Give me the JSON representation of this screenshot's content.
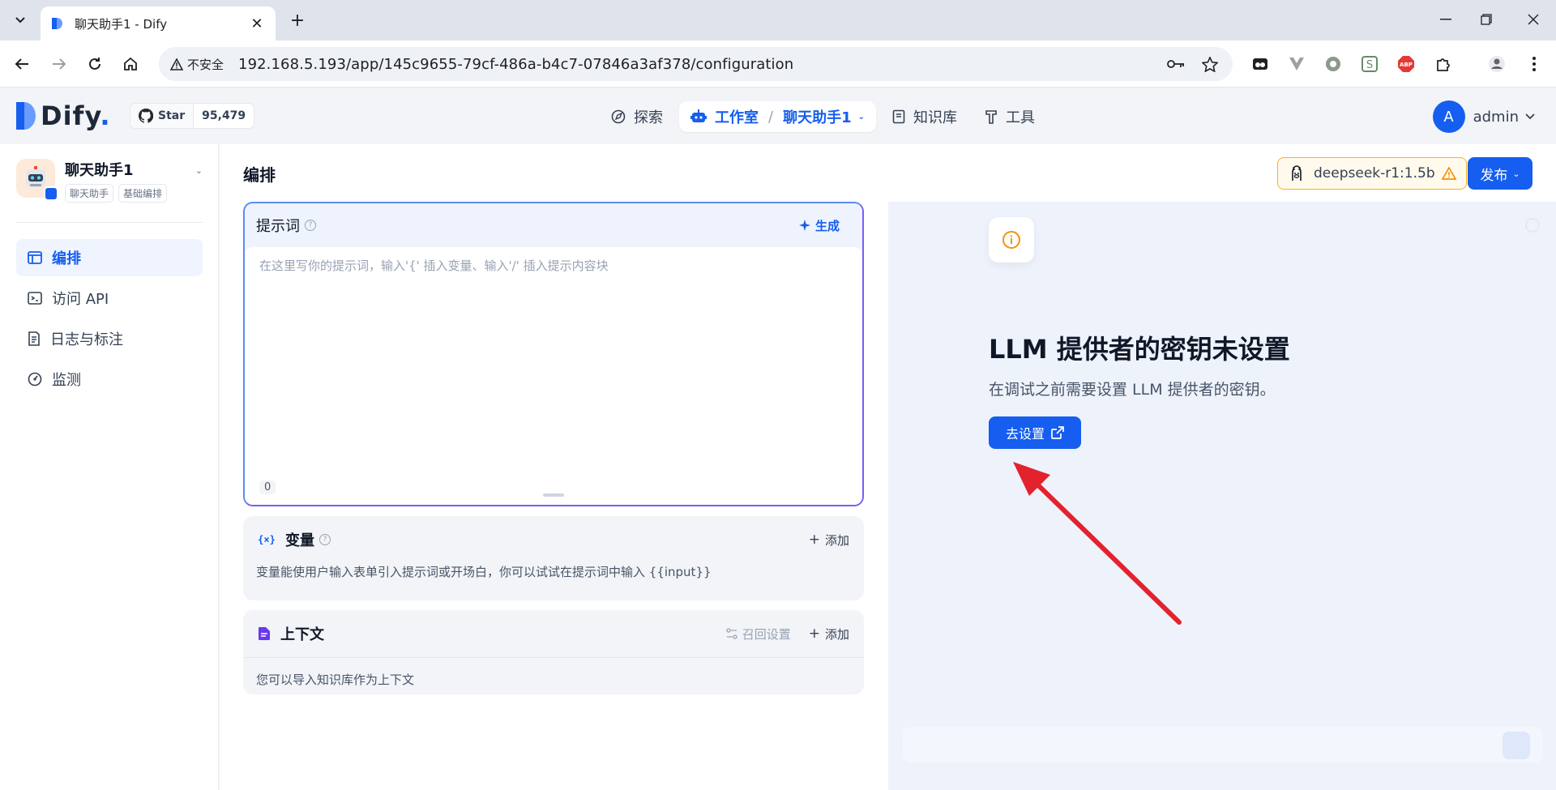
{
  "browser": {
    "tab_title": "聊天助手1 - Dify",
    "insecure_label": "不安全",
    "url": "192.168.5.193/app/145c9655-79cf-486a-b4c7-07846a3af378/configuration"
  },
  "header": {
    "logo_text": "Dify",
    "logo_suffix": ".",
    "star_label": "Star",
    "star_count": "95,479",
    "nav": {
      "explore": "探索",
      "studio": "工作室",
      "breadcrumb_sep": "/",
      "current_app": "聊天助手1",
      "knowledge": "知识库",
      "tools": "工具"
    },
    "user_initial": "A",
    "user_name": "admin"
  },
  "sidebar": {
    "app_name": "聊天助手1",
    "tags": [
      "聊天助手",
      "基础编排"
    ],
    "items": [
      {
        "label": "编排",
        "icon": "layout-icon",
        "active": true
      },
      {
        "label": "访问 API",
        "icon": "terminal-icon",
        "active": false
      },
      {
        "label": "日志与标注",
        "icon": "file-list-icon",
        "active": false
      },
      {
        "label": "监测",
        "icon": "dashboard-icon",
        "active": false
      }
    ]
  },
  "main": {
    "title": "编排",
    "model_label": "deepseek-r1:1.5b",
    "publish_label": "发布",
    "prompt": {
      "label": "提示词",
      "generate_label": "生成",
      "placeholder": "在这里写你的提示词，输入'{' 插入变量、输入'/' 插入提示内容块",
      "char_count": "0"
    },
    "variables": {
      "label": "变量",
      "add_label": "添加",
      "description": "变量能使用户输入表单引入提示词或开场白，你可以试试在提示词中输入 {{input}}"
    },
    "context": {
      "label": "上下文",
      "retrieval_label": "召回设置",
      "add_label": "添加",
      "description": "您可以导入知识库作为上下文"
    }
  },
  "debug": {
    "alert_title": "LLM 提供者的密钥未设置",
    "alert_desc": "在调试之前需要设置 LLM 提供者的密钥。",
    "setup_label": "去设置"
  },
  "colors": {
    "accent": "#155eef",
    "warning": "#f79009",
    "annotation_arrow": "#e3222d"
  }
}
